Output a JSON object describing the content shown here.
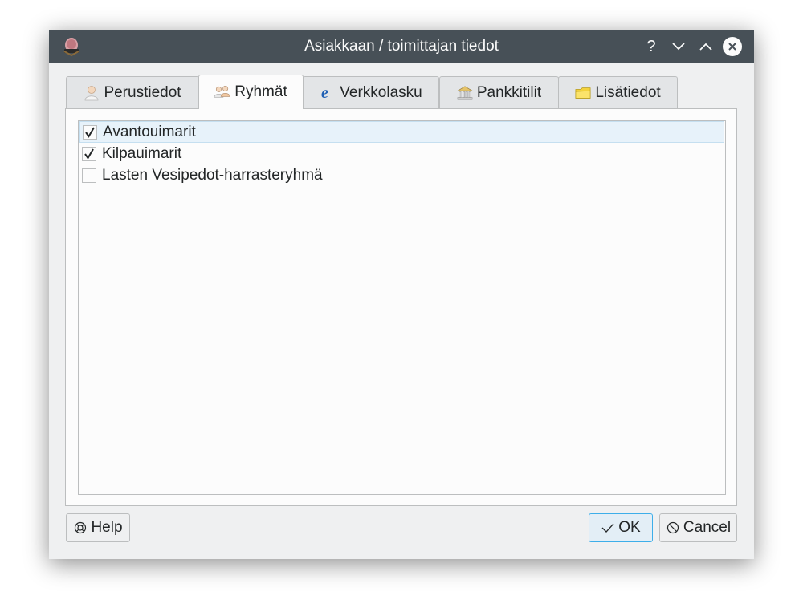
{
  "window": {
    "title": "Asiakkaan / toimittajan tiedot",
    "titlebar_buttons": {
      "help": "?",
      "help_icon": "question-icon",
      "minimize_icon": "chevron-down-icon",
      "maximize_icon": "chevron-up-icon",
      "close_icon": "close-icon"
    },
    "app_icon": "kitupiikki-app-icon"
  },
  "tabs": [
    {
      "label": "Perustiedot",
      "icon": "person-icon",
      "active": false
    },
    {
      "label": "Ryhmät",
      "icon": "group-icon",
      "active": true
    },
    {
      "label": "Verkkolasku",
      "icon": "e-invoice-icon",
      "active": false
    },
    {
      "label": "Pankkitilit",
      "icon": "bank-icon",
      "active": false
    },
    {
      "label": "Lisätiedot",
      "icon": "folder-icon",
      "active": false
    }
  ],
  "groups": [
    {
      "label": "Avantouimarit",
      "checked": true,
      "selected": true
    },
    {
      "label": "Kilpauimarit",
      "checked": true,
      "selected": false
    },
    {
      "label": "Lasten Vesipedot-harrasteryhmä",
      "checked": false,
      "selected": false
    }
  ],
  "buttons": {
    "help": "Help",
    "ok": "OK",
    "cancel": "Cancel",
    "help_icon": "lifebuoy-icon",
    "ok_icon": "checkmark-icon",
    "cancel_icon": "cancel-icon"
  },
  "colors": {
    "titlebar": "#475057",
    "selection": "#e7f2fa",
    "accent": "#3daee9"
  }
}
